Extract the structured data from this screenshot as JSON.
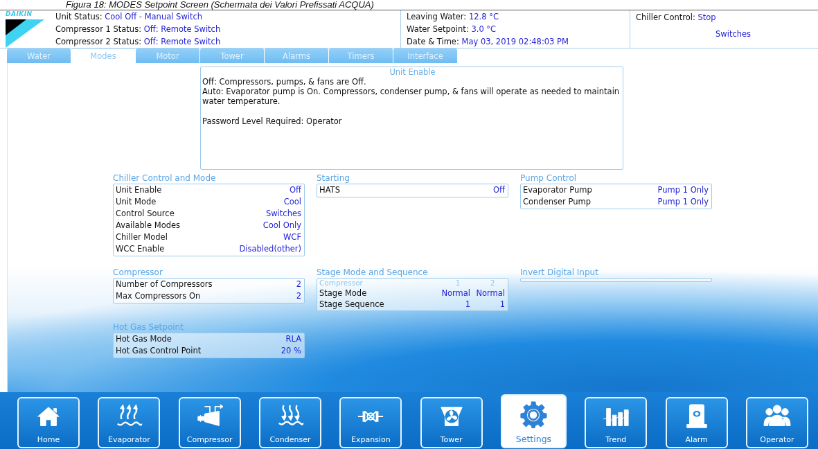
{
  "caption": "Figura 18: MODES Setpoint Screen (Schermata dei Valori Prefissati ACQUA)",
  "logo": {
    "text": "DAIKIN"
  },
  "status": [
    {
      "label": "Unit Status:",
      "value": "Cool Off - Manual Switch"
    },
    {
      "label": "Compressor 1 Status:",
      "value": "Off: Remote Switch"
    },
    {
      "label": "Compressor 2 Status:",
      "value": "Off: Remote Switch"
    }
  ],
  "readings": [
    {
      "label": "Leaving Water:",
      "value": "12.8 °C"
    },
    {
      "label": "Water Setpoint:",
      "value": "3.0 °C"
    },
    {
      "label": "Date & Time:",
      "value": "May 03, 2019  02:48:03 PM"
    }
  ],
  "chiller_control": {
    "label": "Chiller Control:",
    "value": "Stop",
    "source": "Switches"
  },
  "tabs": [
    {
      "label": "Water",
      "selected": false
    },
    {
      "label": "Modes",
      "selected": true
    },
    {
      "label": "Motor",
      "selected": false
    },
    {
      "label": "Tower",
      "selected": false
    },
    {
      "label": "Alarms",
      "selected": false
    },
    {
      "label": "Timers",
      "selected": false
    },
    {
      "label": "Interface",
      "selected": false
    }
  ],
  "info": {
    "title": "Unit Enable",
    "paragraphs": [
      [
        "Off: Compressors, pumps, & fans are Off.",
        "Auto:  Evaporator pump is On. Compressors, condenser pump, & fans will operate as needed to maintain water temperature."
      ],
      [
        "Password Level Required: Operator"
      ]
    ]
  },
  "sections": [
    {
      "title": "Chiller Control and Mode",
      "kind": "list",
      "rows": [
        {
          "label": "Unit Enable",
          "value": "Off"
        },
        {
          "label": "Unit Mode",
          "value": "Cool"
        },
        {
          "label": "Control Source",
          "value": "Switches"
        },
        {
          "label": "Available Modes",
          "value": "Cool Only"
        },
        {
          "label": "Chiller Model",
          "value": "WCF"
        },
        {
          "label": "WCC Enable",
          "value": "Disabled(other)"
        }
      ]
    },
    {
      "title": "Starting",
      "kind": "list",
      "rows": [
        {
          "label": "HATS",
          "value": "Off"
        }
      ]
    },
    {
      "title": "Pump Control",
      "kind": "list",
      "rows": [
        {
          "label": "Evaporator Pump",
          "value": "Pump 1 Only"
        },
        {
          "label": "Condenser Pump",
          "value": "Pump 1 Only"
        }
      ]
    },
    {
      "title": "Compressor",
      "kind": "list",
      "rows": [
        {
          "label": "Number of Compressors",
          "value": "2"
        },
        {
          "label": "Max Compressors On",
          "value": "2"
        }
      ]
    },
    {
      "title": "Stage Mode and Sequence",
      "kind": "table",
      "header": {
        "label": "Compressor",
        "values": [
          "1",
          "2"
        ]
      },
      "rows": [
        {
          "label": "Stage Mode",
          "values": [
            "Normal",
            "Normal"
          ]
        },
        {
          "label": "Stage Sequence",
          "values": [
            "1",
            "1"
          ]
        }
      ]
    },
    {
      "title": "Invert Digital Input",
      "kind": "list"
    },
    {
      "title": "Hot Gas Setpoint",
      "kind": "list",
      "rows": [
        {
          "label": "Hot Gas Mode",
          "value": "RLA"
        },
        {
          "label": "Hot Gas Control Point",
          "value": "20 %"
        }
      ]
    }
  ],
  "nav": [
    {
      "label": "Home",
      "selected": false
    },
    {
      "label": "Evaporator",
      "selected": false
    },
    {
      "label": "Compressor",
      "selected": false
    },
    {
      "label": "Condenser",
      "selected": false
    },
    {
      "label": "Expansion",
      "selected": false
    },
    {
      "label": "Tower",
      "selected": false
    },
    {
      "label": "Settings",
      "selected": true
    },
    {
      "label": "Trend",
      "selected": false
    },
    {
      "label": "Alarm",
      "selected": false
    },
    {
      "label": "Operator",
      "selected": false
    }
  ]
}
